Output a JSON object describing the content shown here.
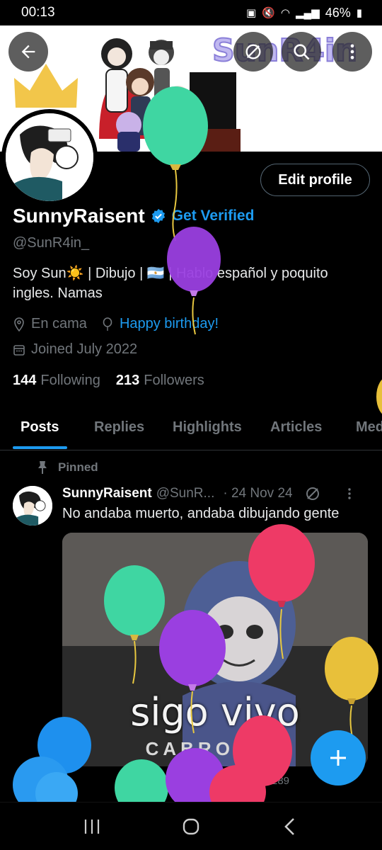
{
  "status_bar": {
    "time": "00:13",
    "battery": "46%"
  },
  "banner": {
    "logo_text": "SunR4in"
  },
  "profile": {
    "edit_label": "Edit profile",
    "display_name": "SunnyRaisent",
    "get_verified": "Get Verified",
    "handle": "@SunR4in_",
    "bio_line1": "Soy Sun☀️ | Dibujo | 🇦🇷 | Hablo español y poquito",
    "bio_line2": "ingles. Namas",
    "location": "En cama",
    "birthday": "Happy birthday!",
    "joined": "Joined July 2022",
    "following_count": "144",
    "following_label": "Following",
    "followers_count": "213",
    "followers_label": "Followers"
  },
  "tabs": [
    "Posts",
    "Replies",
    "Highlights",
    "Articles",
    "Med"
  ],
  "post": {
    "pinned_label": "Pinned",
    "author": "SunnyRaisent",
    "handle": "@SunR...",
    "date": "· 24 Nov 24",
    "text": "No andaba muerto, andaba dibujando gente",
    "media_caption": "sigo vivo",
    "media_subcaption": "CABRONES",
    "views": "289"
  },
  "colors": {
    "accent": "#1d9bf0",
    "background": "#000000",
    "muted": "#71767b"
  }
}
